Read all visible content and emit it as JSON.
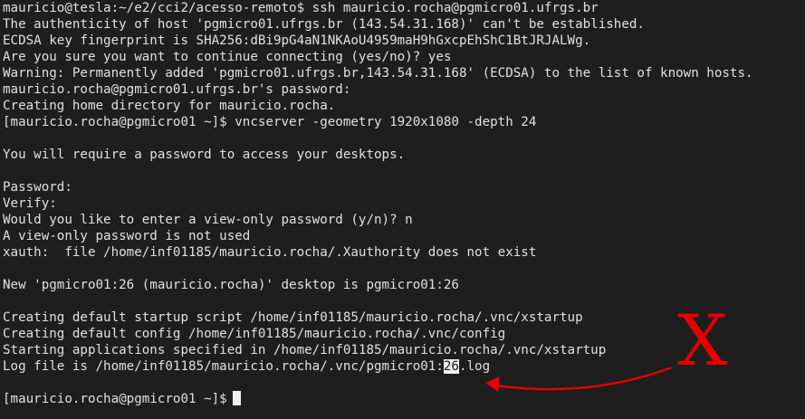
{
  "terminal": {
    "lines": [
      "mauricio@tesla:~/e2/cci2/acesso-remoto$ ssh mauricio.rocha@pgmicro01.ufrgs.br",
      "The authenticity of host 'pgmicro01.ufrgs.br (143.54.31.168)' can't be established.",
      "ECDSA key fingerprint is SHA256:dBi9pG4aN1NKAoU4959maH9hGxcpEhShC1BtJRJALWg.",
      "Are you sure you want to continue connecting (yes/no)? yes",
      "Warning: Permanently added 'pgmicro01.ufrgs.br,143.54.31.168' (ECDSA) to the list of known hosts.",
      "mauricio.rocha@pgmicro01.ufrgs.br's password:",
      "Creating home directory for mauricio.rocha.",
      "[mauricio.rocha@pgmicro01 ~]$ vncserver -geometry 1920x1080 -depth 24",
      "",
      "You will require a password to access your desktops.",
      "",
      "Password:",
      "Verify:",
      "Would you like to enter a view-only password (y/n)? n",
      "A view-only password is not used",
      "xauth:  file /home/inf01185/mauricio.rocha/.Xauthority does not exist",
      "",
      "New 'pgmicro01:26 (mauricio.rocha)' desktop is pgmicro01:26",
      "",
      "Creating default startup script /home/inf01185/mauricio.rocha/.vnc/xstartup",
      "Creating default config /home/inf01185/mauricio.rocha/.vnc/config",
      "Starting applications specified in /home/inf01185/mauricio.rocha/.vnc/xstartup"
    ],
    "logfile_prefix": "Log file is /home/inf01185/mauricio.rocha/.vnc/pgmicro01:",
    "logfile_highlight": "26",
    "logfile_suffix": ".log",
    "prompt": "[mauricio.rocha@pgmicro01 ~]$"
  },
  "annotation": {
    "mark": "X",
    "color": "#e60000"
  }
}
